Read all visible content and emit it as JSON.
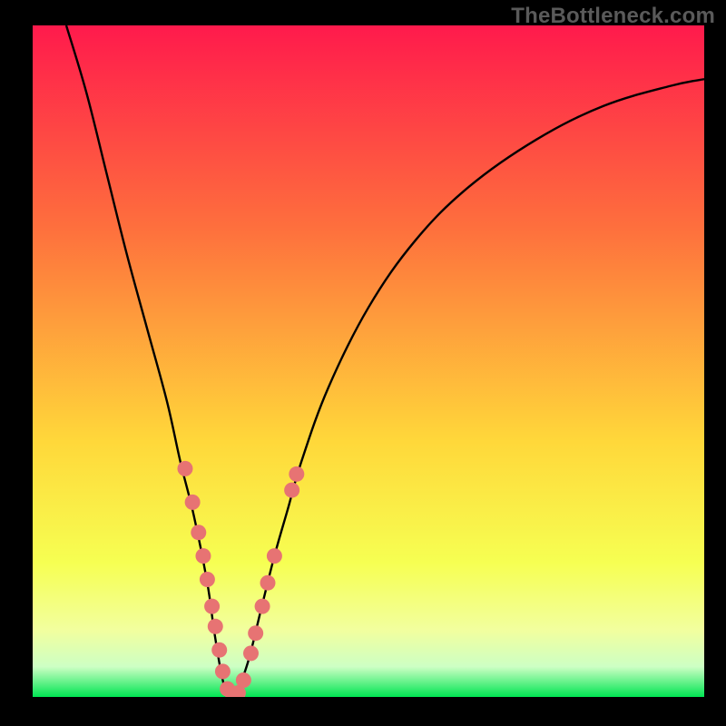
{
  "watermark": "TheBottleneck.com",
  "colors": {
    "black": "#000000",
    "curve": "#000000",
    "dot": "#e77373",
    "grad_top": "#ff1a4c",
    "grad_mid1": "#fe6f3d",
    "grad_mid2": "#ffd83a",
    "grad_low1": "#f6ff52",
    "grad_low2": "#f2ff9e",
    "grad_bottom": "#00e552"
  },
  "chart_data": {
    "type": "line",
    "title": "",
    "xlabel": "",
    "ylabel": "",
    "xlim": [
      0,
      100
    ],
    "ylim": [
      0,
      100
    ],
    "series": [
      {
        "name": "bottleneck-curve",
        "x": [
          5,
          8,
          11,
          14,
          17,
          20,
          22,
          24,
          26,
          27,
          28,
          29,
          30,
          32,
          34,
          36,
          38,
          40,
          44,
          50,
          57,
          65,
          75,
          85,
          95,
          100
        ],
        "y": [
          100,
          90,
          78,
          66,
          55,
          44,
          35,
          27,
          17,
          10,
          4,
          0,
          0,
          5,
          13,
          21,
          28,
          35,
          46,
          58,
          68,
          76,
          83,
          88,
          91,
          92
        ]
      }
    ],
    "scatter": [
      {
        "name": "marker-dots",
        "points": [
          [
            22.7,
            34
          ],
          [
            23.8,
            29
          ],
          [
            24.7,
            24.5
          ],
          [
            25.4,
            21
          ],
          [
            26.0,
            17.5
          ],
          [
            26.7,
            13.5
          ],
          [
            27.2,
            10.5
          ],
          [
            27.8,
            7
          ],
          [
            28.3,
            3.8
          ],
          [
            29.0,
            1.2
          ],
          [
            29.8,
            0.4
          ],
          [
            30.6,
            0.6
          ],
          [
            31.4,
            2.5
          ],
          [
            32.5,
            6.5
          ],
          [
            33.2,
            9.5
          ],
          [
            34.2,
            13.5
          ],
          [
            35.0,
            17
          ],
          [
            36.0,
            21
          ],
          [
            38.6,
            30.8
          ],
          [
            39.3,
            33.2
          ]
        ]
      }
    ],
    "gradient_stops": [
      {
        "offset": 0,
        "color": "#ff1a4c"
      },
      {
        "offset": 0.3,
        "color": "#fe6f3d"
      },
      {
        "offset": 0.62,
        "color": "#ffd83a"
      },
      {
        "offset": 0.8,
        "color": "#f6ff52"
      },
      {
        "offset": 0.9,
        "color": "#f2ff9e"
      },
      {
        "offset": 0.955,
        "color": "#cdffc4"
      },
      {
        "offset": 1.0,
        "color": "#00e552"
      }
    ]
  }
}
